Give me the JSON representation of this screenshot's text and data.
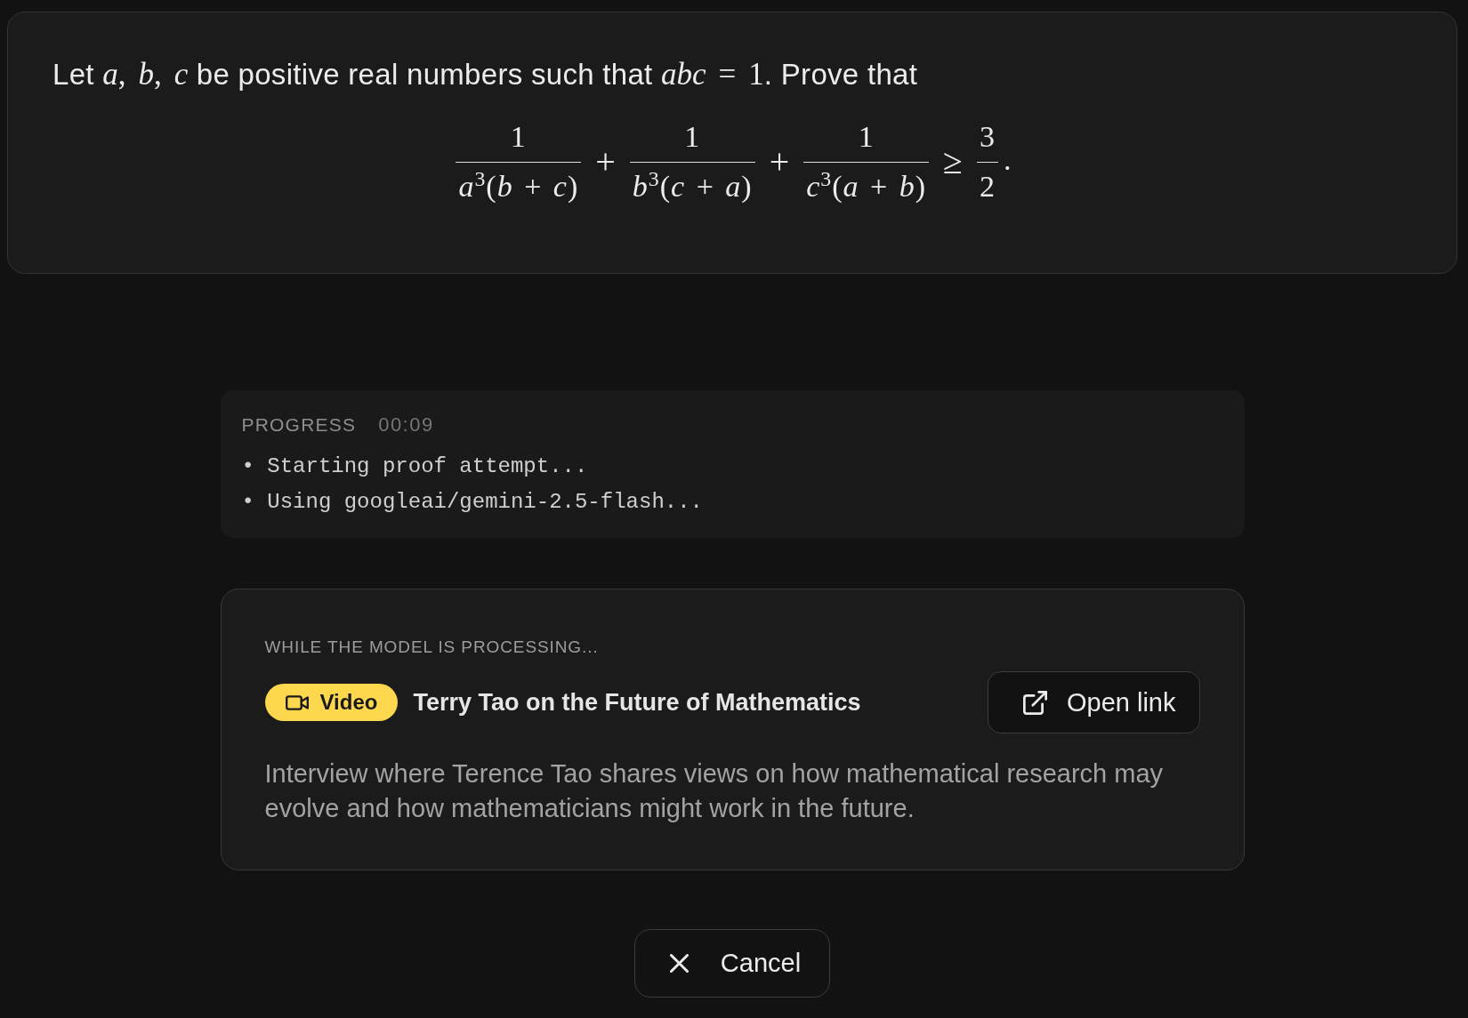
{
  "problem": {
    "statement": [
      {
        "kind": "text",
        "text": "Let "
      },
      {
        "kind": "math",
        "text": "*a*, *b*, *c*"
      },
      {
        "kind": "text",
        "text": " be positive real numbers such that "
      },
      {
        "kind": "math",
        "text": "*abc* = 1"
      },
      {
        "kind": "text",
        "text": ". Prove that"
      }
    ],
    "display_math": [
      {
        "kind": "fraction",
        "numerator": "1",
        "denominator": "*a*$^{3}$(*b* + *c*)"
      },
      {
        "kind": "operator",
        "text": "+"
      },
      {
        "kind": "fraction",
        "numerator": "1",
        "denominator": "*b*$^{3}$(*c* + *a*)"
      },
      {
        "kind": "operator",
        "text": "+"
      },
      {
        "kind": "fraction",
        "numerator": "1",
        "denominator": "*c*$^{3}$(*a* + *b*)"
      },
      {
        "kind": "operator",
        "text": "≥"
      },
      {
        "kind": "fraction",
        "numerator": "3",
        "denominator": "2"
      },
      {
        "kind": "punctuation",
        "text": "."
      }
    ]
  },
  "progress": {
    "label": "PROGRESS",
    "elapsed": "00:09",
    "log": [
      "• Starting proof attempt...",
      "• Using googleai/gemini-2.5-flash..."
    ]
  },
  "suggestion": {
    "heading": "WHILE THE MODEL IS PROCESSING...",
    "badge": {
      "kind": "video",
      "label": "Video"
    },
    "title": "Terry Tao on the Future of Mathematics",
    "button": {
      "label": "Open link"
    },
    "description": "Interview where Terence Tao shares views on how mathematical research may evolve and how mathematicians might work in the future."
  },
  "cancel_button": {
    "label": "Cancel"
  }
}
